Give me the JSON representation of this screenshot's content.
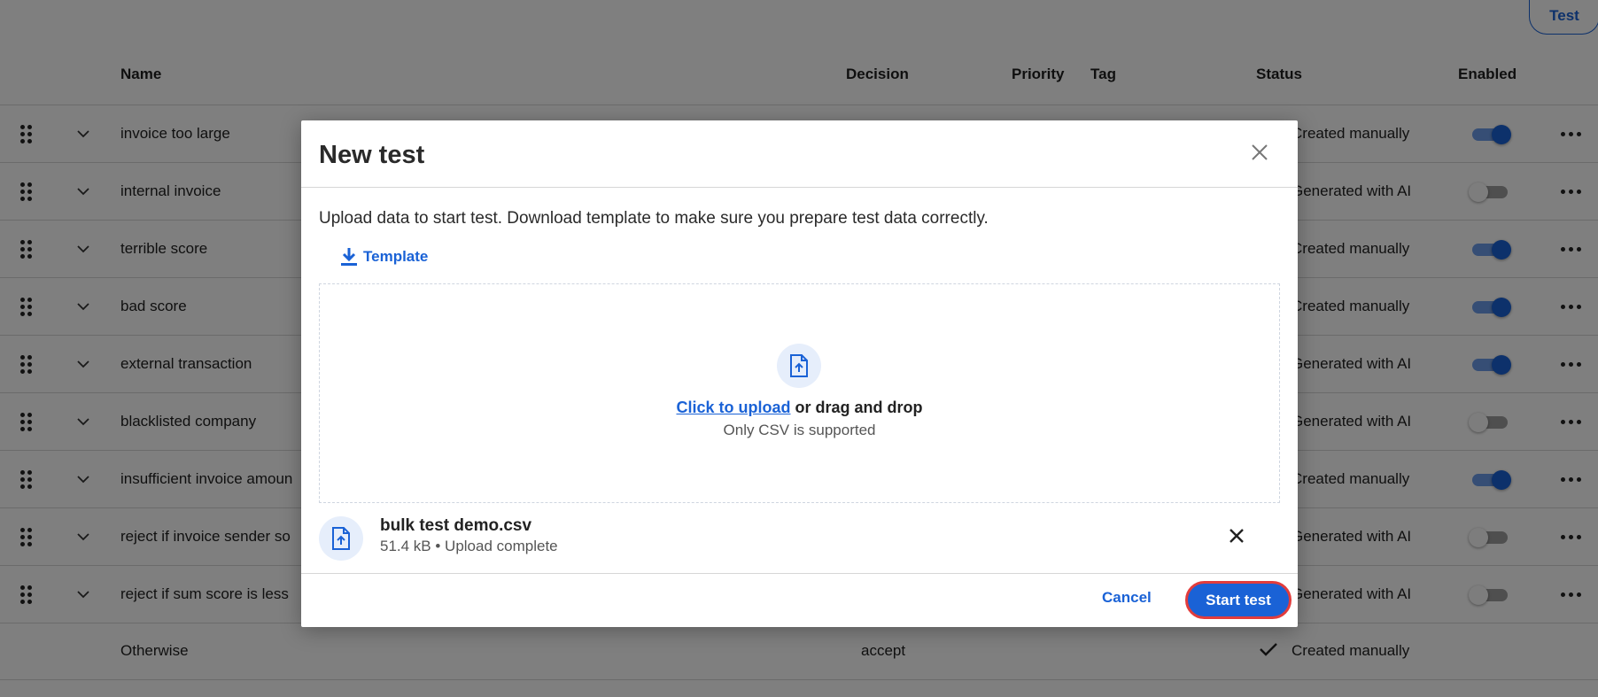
{
  "header": {
    "test_button": "Test"
  },
  "table": {
    "columns": {
      "name": "Name",
      "decision": "Decision",
      "priority": "Priority",
      "tag": "Tag",
      "status": "Status",
      "enabled": "Enabled"
    },
    "rows": [
      {
        "name": "invoice too large",
        "status": "Created manually",
        "enabled": true
      },
      {
        "name": "internal invoice",
        "status": "Generated with AI",
        "enabled": false
      },
      {
        "name": "terrible score",
        "status": "Created manually",
        "enabled": true
      },
      {
        "name": "bad score",
        "status": "Created manually",
        "enabled": true
      },
      {
        "name": "external transaction",
        "status": "Generated with AI",
        "enabled": true
      },
      {
        "name": "blacklisted company",
        "status": "Generated with AI",
        "enabled": false
      },
      {
        "name": "insufficient invoice amoun",
        "status": "Created manually",
        "enabled": true
      },
      {
        "name": "reject if invoice sender so",
        "status": "Generated with AI",
        "enabled": false
      },
      {
        "name": "reject if sum score is less",
        "status": "Generated with AI",
        "enabled": false
      }
    ],
    "otherwise": {
      "name": "Otherwise",
      "decision": "accept",
      "status": "Created manually"
    }
  },
  "modal": {
    "title": "New test",
    "description": "Upload data to start test. Download template to make sure you prepare test data correctly.",
    "template_label": "Template",
    "dropzone": {
      "link_text": "Click to upload",
      "rest_text": " or drag and drop",
      "hint": "Only CSV is supported"
    },
    "file": {
      "name": "bulk test demo.csv",
      "meta": "51.4 kB • Upload complete"
    },
    "cancel_label": "Cancel",
    "start_label": "Start test"
  },
  "colors": {
    "accent": "#1a62d6",
    "highlight_border": "#e23c3c",
    "overlay": "rgba(0,0,0,0.5)"
  }
}
